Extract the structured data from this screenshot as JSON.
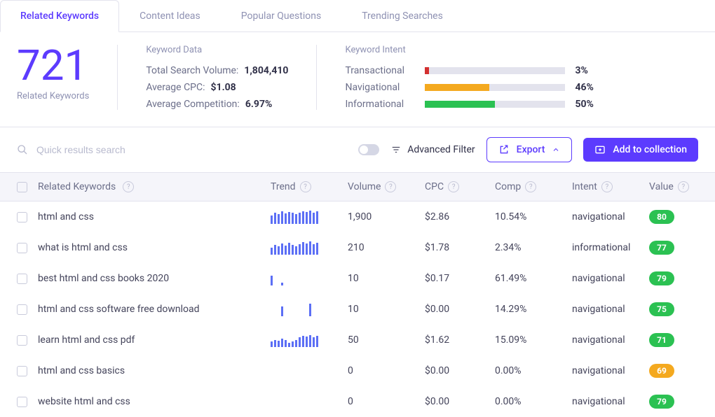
{
  "tabs": [
    "Related Keywords",
    "Content Ideas",
    "Popular Questions",
    "Trending Searches"
  ],
  "activeTab": 0,
  "big": {
    "count": "721",
    "label": "Related Keywords"
  },
  "kd": {
    "title": "Keyword Data",
    "rows": [
      {
        "label": "Total Search Volume:",
        "value": "1,804,410"
      },
      {
        "label": "Average CPC:",
        "value": "$1.08"
      },
      {
        "label": "Average Competition:",
        "value": "6.97%"
      }
    ]
  },
  "ki": {
    "title": "Keyword Intent",
    "rows": [
      {
        "label": "Transactional",
        "pct": 3,
        "pctLabel": "3%",
        "color": "#d33030"
      },
      {
        "label": "Navigational",
        "pct": 46,
        "pctLabel": "46%",
        "color": "#f4a91f"
      },
      {
        "label": "Informational",
        "pct": 50,
        "pctLabel": "50%",
        "color": "#2bc152"
      }
    ]
  },
  "toolbar": {
    "searchPlaceholder": "Quick results search",
    "advancedFilter": "Advanced Filter",
    "export": "Export",
    "addCollection": "Add to collection"
  },
  "columns": [
    "Related Keywords",
    "Trend",
    "Volume",
    "CPC",
    "Comp",
    "Intent",
    "Value"
  ],
  "rows": [
    {
      "keyword": "html and css",
      "trend": [
        12,
        16,
        14,
        18,
        15,
        17,
        16,
        14,
        16,
        18,
        17,
        19,
        16,
        18
      ],
      "volume": "1,900",
      "cpc": "$2.86",
      "comp": "10.54%",
      "intent": "navigational",
      "value": "80",
      "pill": "g"
    },
    {
      "keyword": "what is html and css",
      "trend": [
        10,
        14,
        12,
        16,
        13,
        17,
        14,
        12,
        15,
        18,
        16,
        19,
        15,
        17
      ],
      "volume": "210",
      "cpc": "$1.78",
      "comp": "2.34%",
      "intent": "informational",
      "value": "77",
      "pill": "g"
    },
    {
      "keyword": "best html and css books 2020",
      "trend": [
        14,
        0,
        0,
        4,
        0,
        0,
        0,
        0,
        0,
        0,
        0,
        0,
        0,
        0
      ],
      "volume": "10",
      "cpc": "$0.17",
      "comp": "61.49%",
      "intent": "navigational",
      "value": "79",
      "pill": "g"
    },
    {
      "keyword": "html and css software free download",
      "trend": [
        0,
        0,
        0,
        14,
        0,
        0,
        0,
        0,
        0,
        0,
        0,
        18,
        0,
        0
      ],
      "volume": "10",
      "cpc": "$0.00",
      "comp": "14.29%",
      "intent": "navigational",
      "value": "75",
      "pill": "g"
    },
    {
      "keyword": "learn html and css pdf",
      "trend": [
        8,
        10,
        9,
        12,
        10,
        6,
        8,
        10,
        14,
        16,
        15,
        17,
        14,
        16
      ],
      "volume": "50",
      "cpc": "$1.62",
      "comp": "15.09%",
      "intent": "navigational",
      "value": "71",
      "pill": "g"
    },
    {
      "keyword": "html and css basics",
      "trend": [
        0,
        0,
        0,
        0,
        0,
        0,
        0,
        0,
        0,
        0,
        0,
        0,
        0,
        0
      ],
      "volume": "0",
      "cpc": "$0.00",
      "comp": "0.00%",
      "intent": "navigational",
      "value": "69",
      "pill": "y"
    },
    {
      "keyword": "website html and css",
      "trend": [
        0,
        0,
        0,
        0,
        0,
        0,
        0,
        0,
        0,
        0,
        0,
        0,
        0,
        0
      ],
      "volume": "0",
      "cpc": "$0.00",
      "comp": "0.00%",
      "intent": "navigational",
      "value": "79",
      "pill": "g"
    }
  ]
}
